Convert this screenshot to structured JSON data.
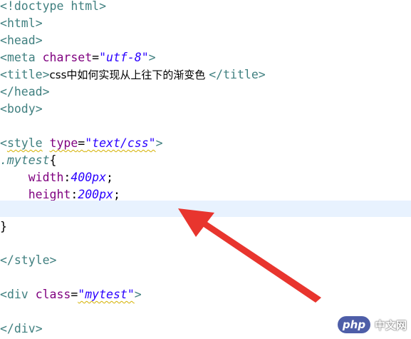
{
  "code": {
    "line1": {
      "punct_open": "<!",
      "tag": "doctype html",
      "punct_close": ">"
    },
    "line2": {
      "open": "<",
      "tag": "html",
      "close": ">"
    },
    "line3": {
      "open": "<",
      "tag": "head",
      "close": ">"
    },
    "line4": {
      "open": "<",
      "tag": "meta",
      "attr": "charset",
      "eq": "=",
      "value": "\"utf-8\"",
      "close": ">"
    },
    "line5": {
      "open": "<",
      "tag": "title",
      "close": ">",
      "text": "css中如何实现从上往下的渐变色 ",
      "end_open": "</",
      "end_tag": "title",
      "end_close": ">"
    },
    "line6": {
      "open": "</",
      "tag": "head",
      "close": ">"
    },
    "line7": {
      "open": "<",
      "tag": "body",
      "close": ">"
    },
    "line9": {
      "open": "<",
      "tag": "style",
      "attr": "type",
      "eq": "=",
      "value": "\"text/css\"",
      "close": ">"
    },
    "line10": {
      "selector": ".mytest",
      "brace": "{"
    },
    "line11": {
      "indent": "    ",
      "prop": "width",
      "colon": ":",
      "value": "400px",
      "semi": ";"
    },
    "line12": {
      "indent": "    ",
      "prop": "height",
      "colon": ":",
      "value": "200px",
      "semi": ";"
    },
    "line14": {
      "brace": "}"
    },
    "line16": {
      "open": "</",
      "tag": "style",
      "close": ">"
    },
    "line18": {
      "open": "<",
      "tag": "div",
      "attr": "class",
      "eq": "=",
      "value": "\"mytest\"",
      "close": ">"
    },
    "line20": {
      "open": "</",
      "tag": "div",
      "close": ">"
    }
  },
  "watermark": {
    "logo": "php",
    "text": "中文网"
  },
  "colors": {
    "tag": "#3f7f7f",
    "attribute": "#7f007f",
    "value": "#2a00ff",
    "current_line": "#e8f2fe",
    "arrow": "#e8352e"
  }
}
